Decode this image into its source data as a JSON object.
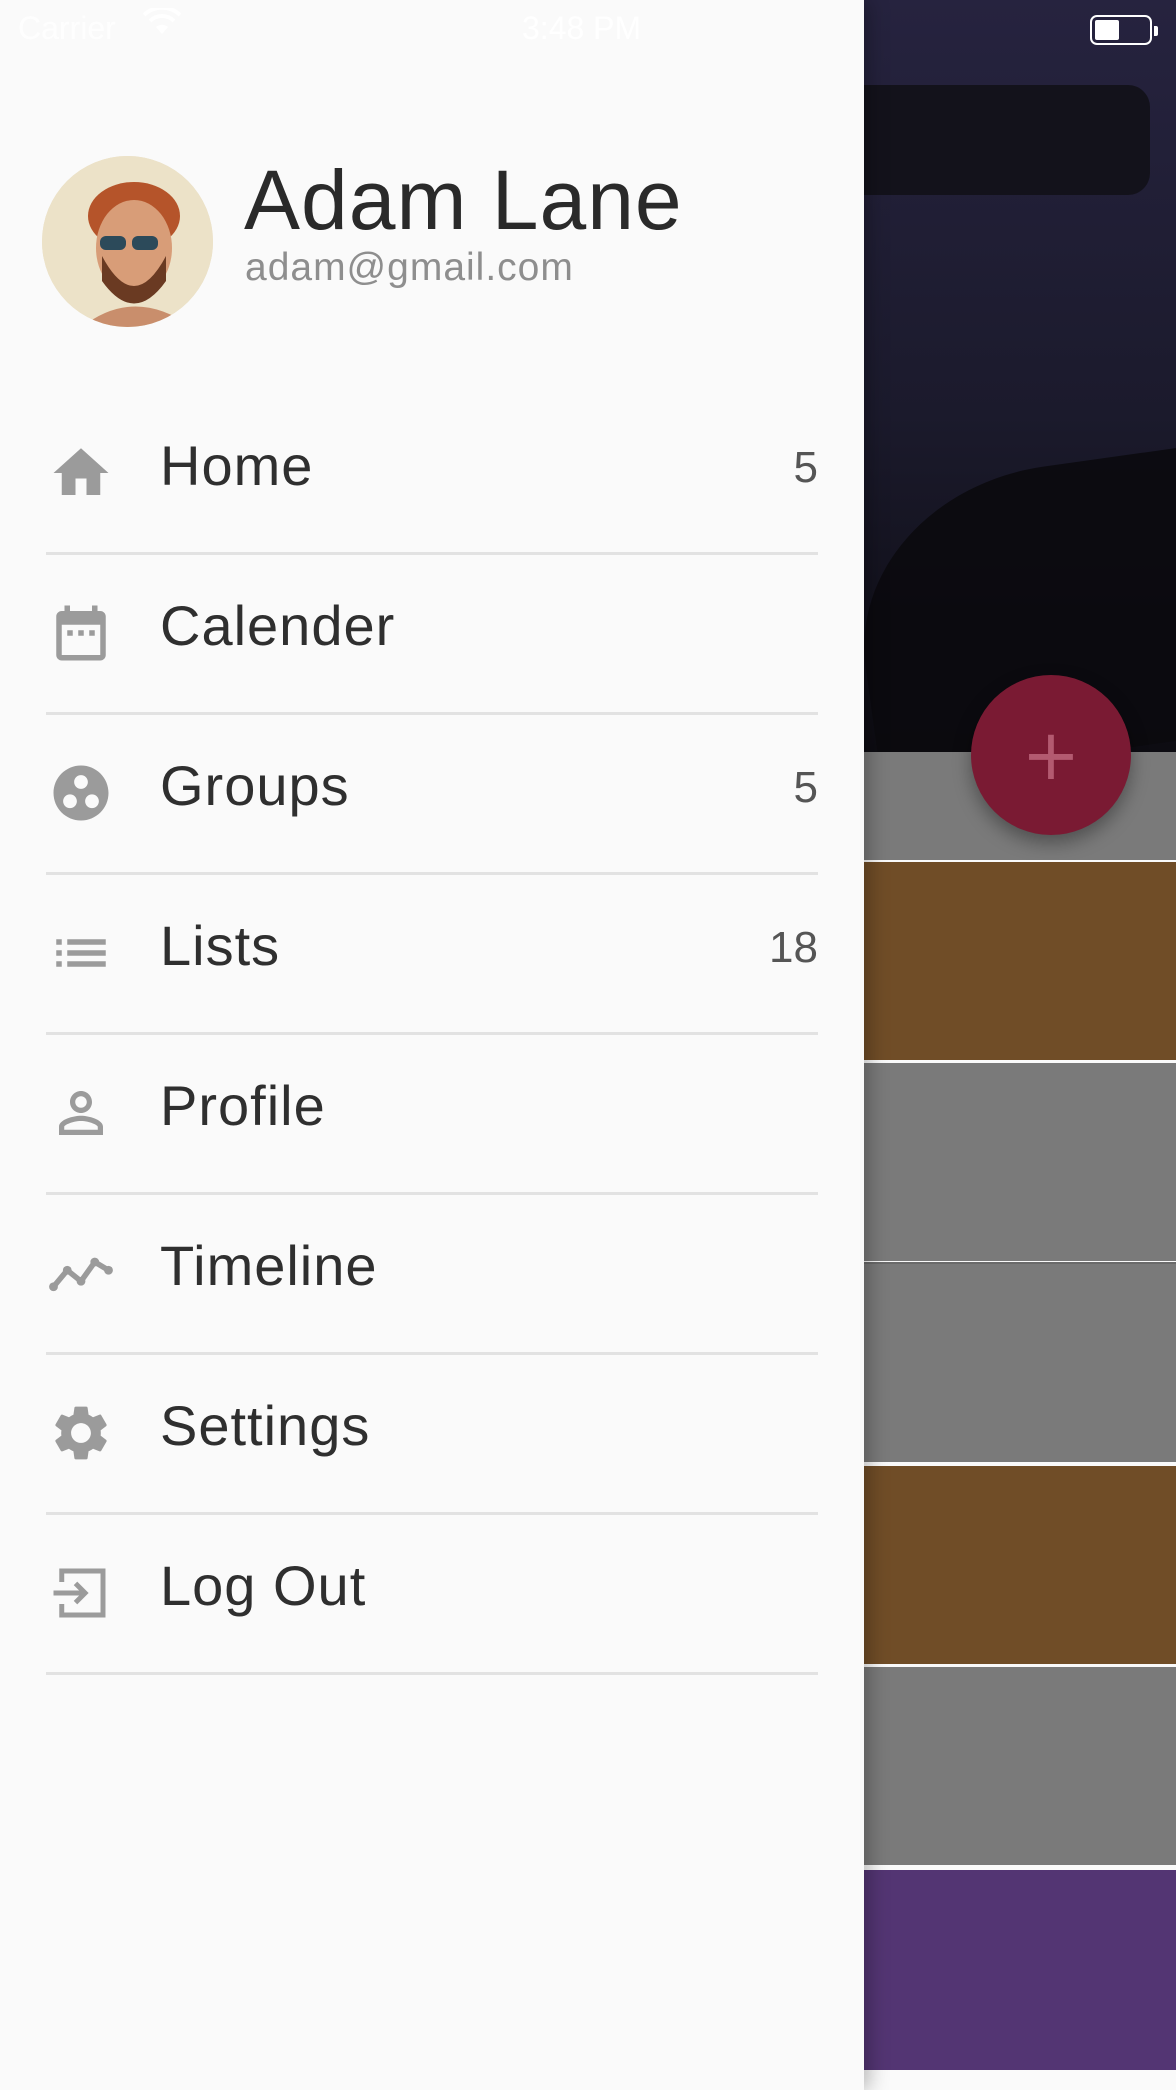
{
  "status_bar": {
    "carrier": "Carrier",
    "time": "3:48 PM"
  },
  "user": {
    "name": "Adam Lane",
    "email": "adam@gmail.com"
  },
  "menu": [
    {
      "label": "Home",
      "badge": "5",
      "icon": "home-icon"
    },
    {
      "label": "Calender",
      "badge": "",
      "icon": "calendar-icon"
    },
    {
      "label": "Groups",
      "badge": "5",
      "icon": "groups-icon"
    },
    {
      "label": "Lists",
      "badge": "18",
      "icon": "list-icon"
    },
    {
      "label": "Profile",
      "badge": "",
      "icon": "person-icon"
    },
    {
      "label": "Timeline",
      "badge": "",
      "icon": "timeline-icon"
    },
    {
      "label": "Settings",
      "badge": "",
      "icon": "gear-icon"
    },
    {
      "label": "Log Out",
      "badge": "",
      "icon": "logout-icon"
    }
  ],
  "background": {
    "fab_label": "+",
    "card_colors": [
      "#7a7a7a",
      "#704d27",
      "#7a7a7a",
      "#7a7a7a",
      "#704d27",
      "#7a7a7a",
      "#533573"
    ]
  },
  "colors": {
    "icon": "#9b9b9b",
    "fab": "#7a1a33",
    "drawer": "#fafafa"
  }
}
